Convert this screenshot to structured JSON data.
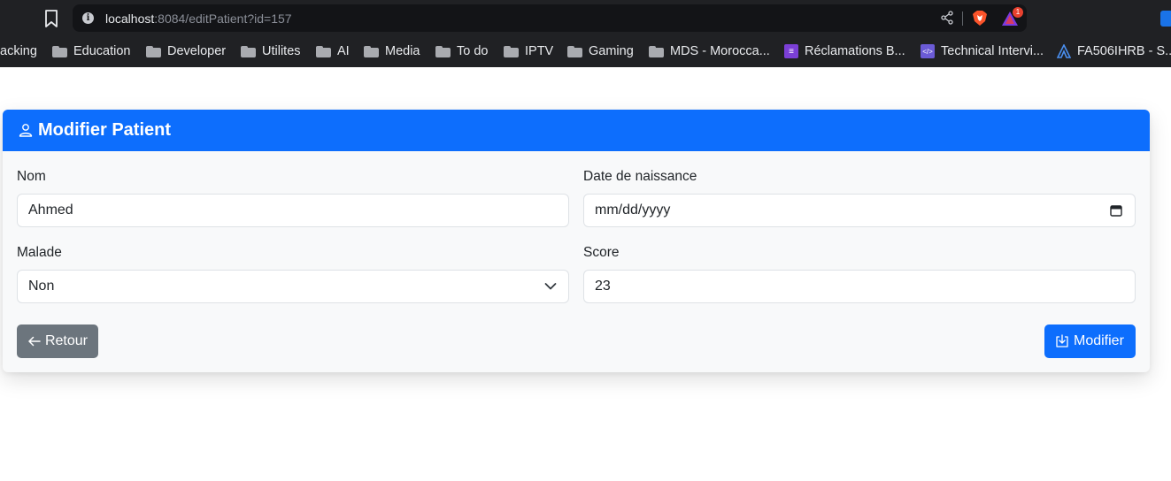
{
  "browser": {
    "url_host": "localhost",
    "url_path": ":8084/editPatient?id=157",
    "rewards_badge": "1",
    "bookmarks": [
      {
        "label": "acking",
        "icon": "none"
      },
      {
        "label": "Education",
        "icon": "folder-icon"
      },
      {
        "label": "Developer",
        "icon": "folder-icon"
      },
      {
        "label": "Utilites",
        "icon": "folder-icon"
      },
      {
        "label": "AI",
        "icon": "folder-icon"
      },
      {
        "label": "Media",
        "icon": "folder-icon"
      },
      {
        "label": "To do",
        "icon": "folder-icon"
      },
      {
        "label": "IPTV",
        "icon": "folder-icon"
      },
      {
        "label": "Gaming",
        "icon": "folder-icon"
      },
      {
        "label": "MDS - Morocca...",
        "icon": "folder-icon"
      },
      {
        "label": "Réclamations B...",
        "icon": "list-icon"
      },
      {
        "label": "Technical Intervi...",
        "icon": "code-icon"
      },
      {
        "label": "FA506IHRB - S...",
        "icon": "asus-icon"
      }
    ]
  },
  "card": {
    "title": "Modifier Patient",
    "header_color": "#0d6efd"
  },
  "form": {
    "nom_label": "Nom",
    "nom_value": "Ahmed",
    "date_label": "Date de naissance",
    "date_value": "mm/dd/yyyy",
    "malade_label": "Malade",
    "malade_value": "Non",
    "score_label": "Score",
    "score_value": "23"
  },
  "actions": {
    "back_label": "Retour",
    "save_label": "Modifier"
  }
}
